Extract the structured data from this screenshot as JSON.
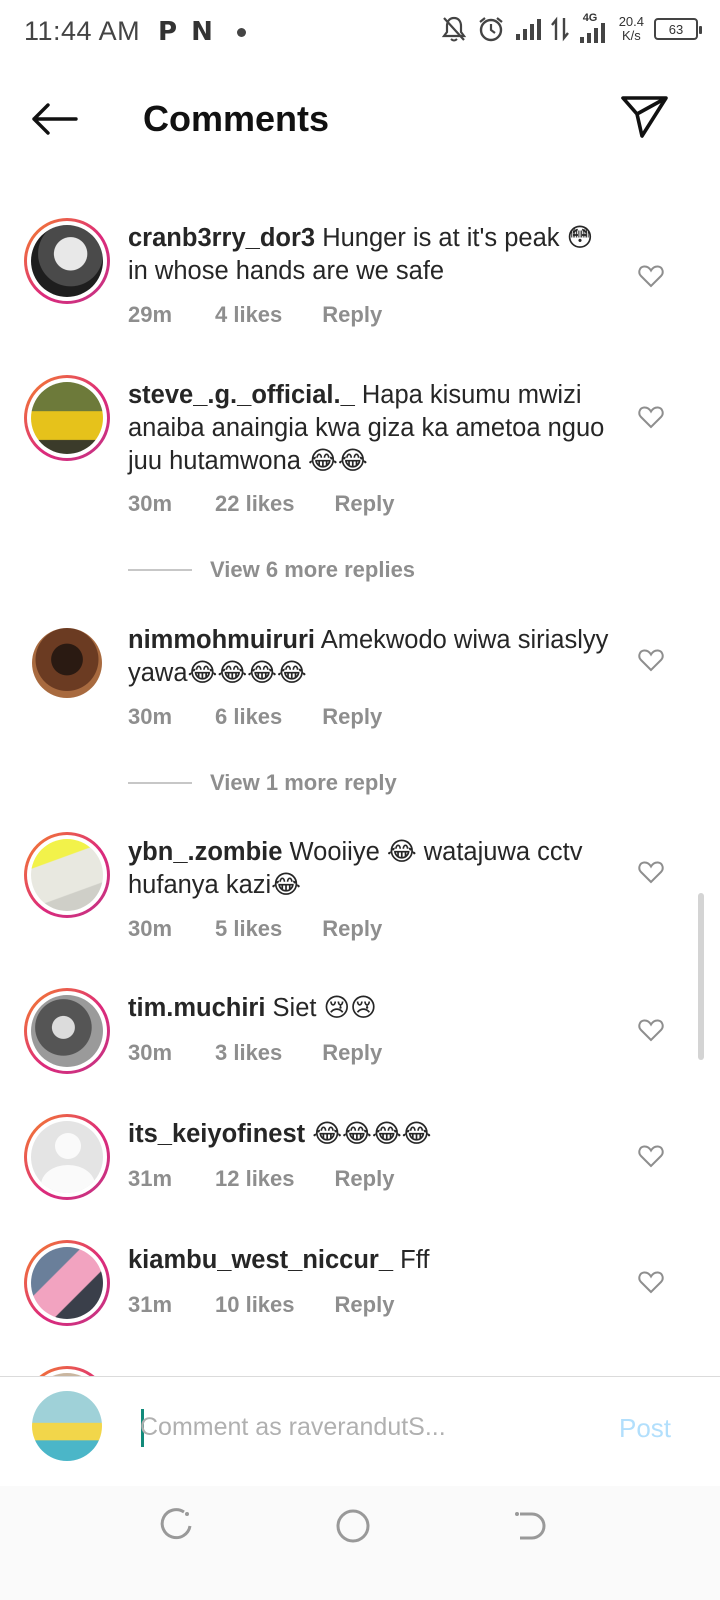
{
  "status_bar": {
    "time": "11:44 AM",
    "left_icons": [
      "P",
      "N"
    ],
    "network_type": "4G",
    "speed_value": "20.4",
    "speed_unit": "K/s",
    "battery_level": "63"
  },
  "header": {
    "title": "Comments"
  },
  "comments": [
    {
      "username": "cranb3rry_dor3",
      "text": "Hunger is at it's peak 😳 in whose hands are we safe",
      "time": "29m",
      "likes": "4 likes",
      "reply": "Reply"
    },
    {
      "username": "steve_.g._official._",
      "text": "Hapa kisumu mwizi anaiba anaingia kwa giza ka ametoa nguo juu hutamwona 😂😂",
      "time": "30m",
      "likes": "22 likes",
      "reply": "Reply",
      "view_replies": "View 6 more replies"
    },
    {
      "username": "nimmohmuiruri",
      "text": "Amekwodo wiwa siriaslyy yawa😂😂😂😂",
      "time": "30m",
      "likes": "6 likes",
      "reply": "Reply",
      "view_replies": "View 1 more reply"
    },
    {
      "username": "ybn_.zombie",
      "text": "Wooiiye 😂 watajuwa cctv hufanya kazi😂",
      "time": "30m",
      "likes": "5 likes",
      "reply": "Reply"
    },
    {
      "username": "tim.muchiri",
      "text": "Siet 😢😢",
      "time": "30m",
      "likes": "3 likes",
      "reply": "Reply"
    },
    {
      "username": "its_keiyofinest",
      "text": "😂😂😂😂",
      "time": "31m",
      "likes": "12 likes",
      "reply": "Reply"
    },
    {
      "username": "kiambu_west_niccur_",
      "text": "Fff",
      "time": "31m",
      "likes": "10 likes",
      "reply": "Reply"
    }
  ],
  "composer": {
    "placeholder": "Comment as raverandutS...",
    "post_label": "Post"
  },
  "colors": {
    "story_ring_start": "#f58529",
    "story_ring_end": "#c13584",
    "post_disabled": "#b2dffc",
    "meta_gray": "#8e8e8e"
  }
}
